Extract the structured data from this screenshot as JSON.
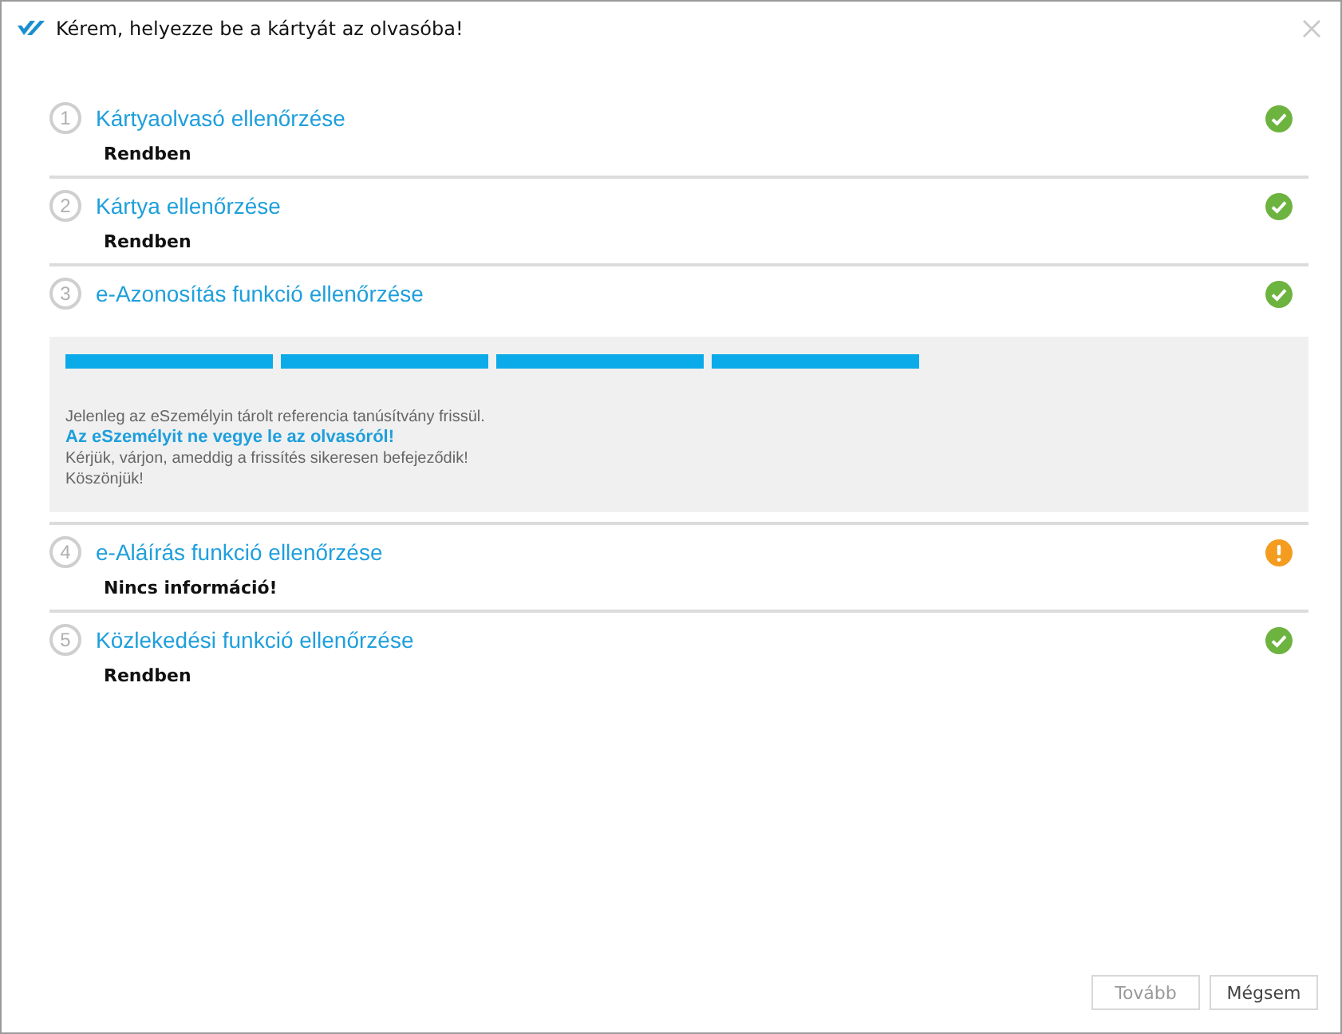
{
  "window": {
    "title": "Kérem, helyezze be a kártyát az olvasóba!"
  },
  "steps": [
    {
      "number": "1",
      "title": "Kártyaolvasó ellenőrzése",
      "ok": true,
      "result": "Rendben"
    },
    {
      "number": "2",
      "title": "Kártya ellenőrzése",
      "ok": true,
      "result": "Rendben"
    },
    {
      "number": "3",
      "title": "e-Azonosítás funkció ellenőrzése",
      "ok": true,
      "panel": {
        "segments": [
          {
            "filled": true
          },
          {
            "filled": true
          },
          {
            "filled": true
          },
          {
            "filled": true
          }
        ],
        "lines": [
          {
            "kind": "normal",
            "text": "Jelenleg az eSzemélyin tárolt referencia tanúsítvány frissül."
          },
          {
            "kind": "warning",
            "text": "Az eSzemélyit ne vegye le az olvasóról!"
          },
          {
            "kind": "normal",
            "text": "Kérjük, várjon, ameddig a frissítés sikeresen befejeződik!"
          },
          {
            "kind": "normal",
            "text": "Köszönjük!"
          }
        ]
      }
    },
    {
      "number": "4",
      "title": "e-Aláírás funkció ellenőrzése",
      "ok": false,
      "result": "Nincs információ!"
    },
    {
      "number": "5",
      "title": "Közlekedési funkció ellenőrzése",
      "ok": true,
      "result": "Rendben"
    }
  ],
  "buttons": [
    {
      "label": "Tovább",
      "disabled": true
    },
    {
      "label": "Mégsem",
      "disabled": false
    }
  ]
}
